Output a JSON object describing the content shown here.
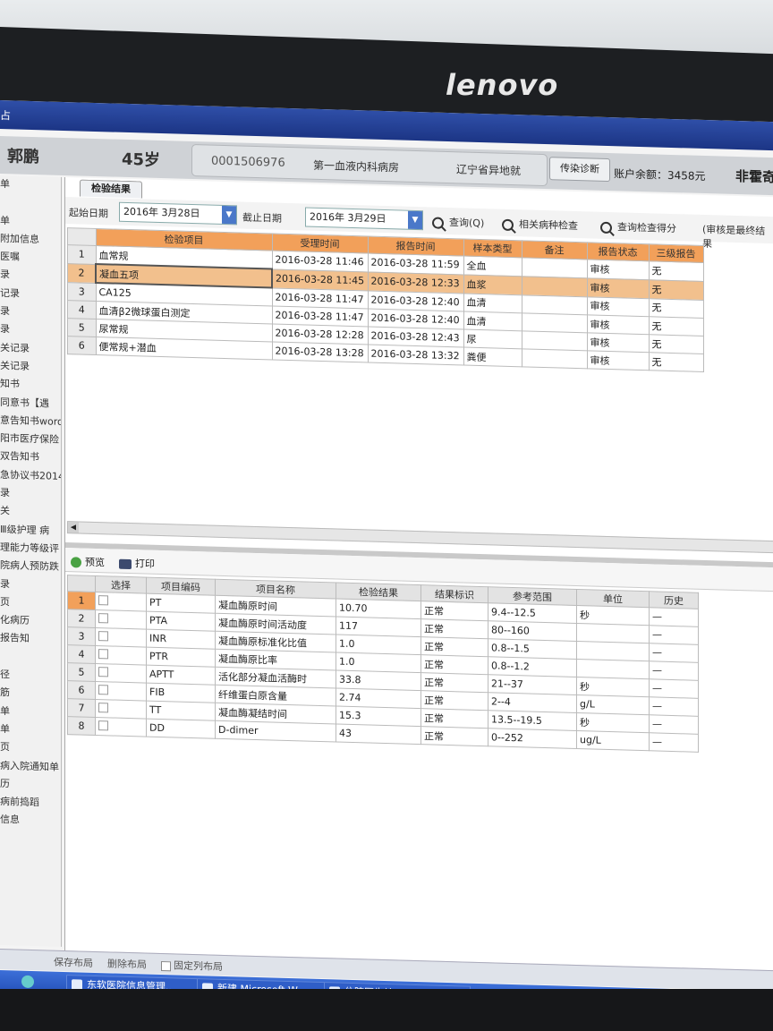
{
  "monitor": {
    "brand": "lenovo"
  },
  "window": {
    "title_fragment": "占"
  },
  "patient": {
    "name": "郭鹏",
    "age": "45岁",
    "id": "0001506976",
    "department": "第一血液内科病房",
    "insurance": "辽宁省异地就",
    "diagnosis_button": "传染诊断",
    "balance": "账户余额：3458元",
    "extra": "非霍奇"
  },
  "sidebar": {
    "items": [
      "单",
      "",
      "单",
      "附加信息",
      "医嘱",
      "录",
      "记录",
      "录",
      "录",
      "关记录",
      "关记录",
      "知书",
      "同意书【遇",
      "意告知书word",
      "阳市医疗保险",
      "双告知书",
      "急协议书2014",
      "录",
      "关",
      "Ⅲ级护理 病",
      "理能力等级评",
      "院病人预防跌",
      "录",
      "页",
      "化病历",
      "报告知",
      "",
      "径",
      "筋",
      "单",
      "单",
      "页",
      "病入院通知单",
      "历",
      "病前捣蹈",
      "信息"
    ]
  },
  "tab": {
    "label": "检验结果"
  },
  "filter": {
    "start_label": "起始日期",
    "start_date": "2016年 3月28日",
    "end_label": "截止日期",
    "end_date": "2016年 3月29日",
    "query_label": "查询(Q)",
    "related_label": "相关病种检查",
    "score_label": "查询检查得分",
    "note_label": "(审核是最终结果"
  },
  "tests": {
    "headers": [
      "检验项目",
      "受理时间",
      "报告时间",
      "样本类型",
      "备注",
      "报告状态",
      "三级报告"
    ],
    "rows": [
      {
        "no": "1",
        "item": "血常规",
        "accept": "2016-03-28 11:46",
        "report": "2016-03-28 11:59",
        "sample": "全血",
        "note": "",
        "status": "审核",
        "level3": "无"
      },
      {
        "no": "2",
        "item": "凝血五项",
        "accept": "2016-03-28 11:45",
        "report": "2016-03-28 12:33",
        "sample": "血浆",
        "note": "",
        "status": "审核",
        "level3": "无"
      },
      {
        "no": "3",
        "item": "CA125",
        "accept": "2016-03-28 11:47",
        "report": "2016-03-28 12:40",
        "sample": "血清",
        "note": "",
        "status": "审核",
        "level3": "无"
      },
      {
        "no": "4",
        "item": "血清β2微球蛋白测定",
        "accept": "2016-03-28 11:47",
        "report": "2016-03-28 12:40",
        "sample": "血清",
        "note": "",
        "status": "审核",
        "level3": "无"
      },
      {
        "no": "5",
        "item": "尿常规",
        "accept": "2016-03-28 12:28",
        "report": "2016-03-28 12:43",
        "sample": "尿",
        "note": "",
        "status": "审核",
        "level3": "无"
      },
      {
        "no": "6",
        "item": "便常规+潜血",
        "accept": "2016-03-28 13:28",
        "report": "2016-03-28 13:32",
        "sample": "粪便",
        "note": "",
        "status": "审核",
        "level3": "无"
      }
    ]
  },
  "toolbar2": {
    "preview": "预览",
    "print": "打印"
  },
  "results": {
    "headers": [
      "选择",
      "项目编码",
      "项目名称",
      "检验结果",
      "结果标识",
      "参考范围",
      "单位",
      "历史"
    ],
    "rows": [
      {
        "no": "1",
        "code": "PT",
        "name": "凝血酶原时间",
        "value": "10.70",
        "flag": "正常",
        "range": "9.4--12.5",
        "unit": "秒",
        "history": "—"
      },
      {
        "no": "2",
        "code": "PTA",
        "name": "凝血酶原时间活动度",
        "value": "117",
        "flag": "正常",
        "range": "80--160",
        "unit": "",
        "history": "—"
      },
      {
        "no": "3",
        "code": "INR",
        "name": "凝血酶原标准化比值",
        "value": "1.0",
        "flag": "正常",
        "range": "0.8--1.5",
        "unit": "",
        "history": "—"
      },
      {
        "no": "4",
        "code": "PTR",
        "name": "凝血酶原比率",
        "value": "1.0",
        "flag": "正常",
        "range": "0.8--1.2",
        "unit": "",
        "history": "—"
      },
      {
        "no": "5",
        "code": "APTT",
        "name": "活化部分凝血活酶时",
        "value": "33.8",
        "flag": "正常",
        "range": "21--37",
        "unit": "秒",
        "history": "—"
      },
      {
        "no": "6",
        "code": "FIB",
        "name": "纤维蛋白原含量",
        "value": "2.74",
        "flag": "正常",
        "range": "2--4",
        "unit": "g/L",
        "history": "—"
      },
      {
        "no": "7",
        "code": "TT",
        "name": "凝血酶凝结时间",
        "value": "15.3",
        "flag": "正常",
        "range": "13.5--19.5",
        "unit": "秒",
        "history": "—"
      },
      {
        "no": "8",
        "code": "DD",
        "name": "D-dimer",
        "value": "43",
        "flag": "正常",
        "range": "0--252",
        "unit": "ug/L",
        "history": "—"
      }
    ]
  },
  "statusbar": {
    "save_layout": "保存布局",
    "delete_layout": "删除布局",
    "lock_layout": "固定列布局"
  },
  "taskbar": {
    "items": [
      "东软医院信息管理...",
      "新建 Microsoft W...",
      "住院医生站"
    ]
  }
}
